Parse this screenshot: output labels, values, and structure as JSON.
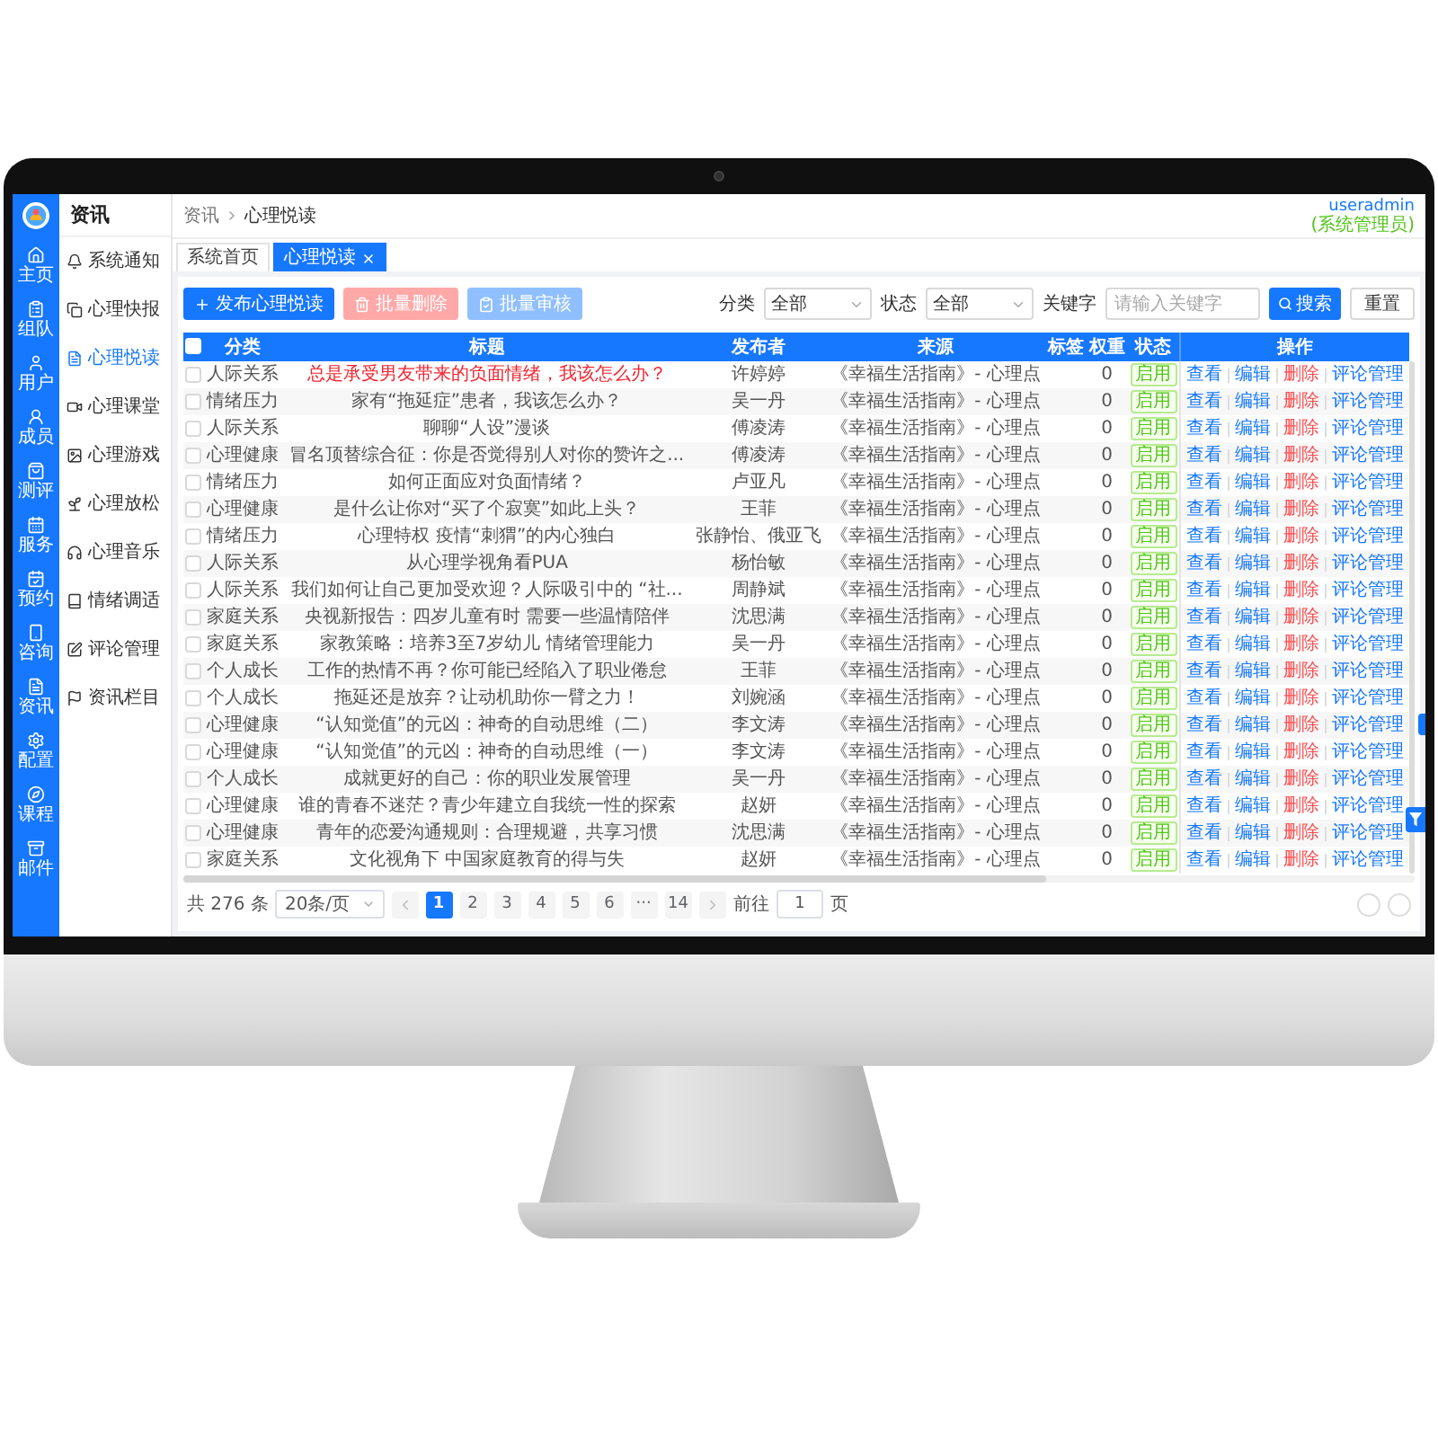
{
  "nav_sidebar": {
    "items": [
      "主页",
      "组队",
      "用户",
      "成员",
      "测评",
      "服务",
      "预约",
      "咨询",
      "资讯",
      "配置",
      "课程",
      "邮件"
    ]
  },
  "sub_sidebar": {
    "title": "资讯",
    "items": [
      {
        "label": "系统通知",
        "selected": false
      },
      {
        "label": "心理快报",
        "selected": false
      },
      {
        "label": "心理悦读",
        "selected": true
      },
      {
        "label": "心理课堂",
        "selected": false
      },
      {
        "label": "心理游戏",
        "selected": false
      },
      {
        "label": "心理放松",
        "selected": false
      },
      {
        "label": "心理音乐",
        "selected": false
      },
      {
        "label": "情绪调适",
        "selected": false
      },
      {
        "label": "评论管理",
        "selected": false
      },
      {
        "label": "资讯栏目",
        "selected": false
      }
    ]
  },
  "breadcrumb": [
    "资讯",
    "心理悦读"
  ],
  "user": {
    "name": "useradmin",
    "role": "(系统管理员)"
  },
  "tabs": [
    {
      "label": "系统首页",
      "selected": false,
      "closable": false
    },
    {
      "label": "心理悦读",
      "selected": true,
      "closable": true
    }
  ],
  "toolbar": {
    "buttons": [
      {
        "kind": "add",
        "label": "发布心理悦读",
        "disabled": false
      },
      {
        "kind": "delete",
        "label": "批量删除",
        "disabled": true
      },
      {
        "kind": "review",
        "label": "批量审核",
        "disabled": true
      }
    ],
    "filters": [
      {
        "kind": "select",
        "label": "分类",
        "value": "全部"
      },
      {
        "kind": "select",
        "label": "状态",
        "value": "全部"
      },
      {
        "kind": "input",
        "label": "关键字",
        "placeholder": "请输入关键字"
      }
    ],
    "search_button": "搜索",
    "reset_button": "重置"
  },
  "table": {
    "select_all_checked": false,
    "columns": [
      "分类",
      "标题",
      "发布者",
      "来源",
      "标签",
      "权重",
      "状态",
      "操作"
    ],
    "rows": [
      {
        "checked": false,
        "category": "人际关系",
        "title": "总是承受男友带来的负面情绪，我该怎么办？",
        "highlighted": true,
        "author": "许婷婷",
        "source": "《幸福生活指南》- 心理点",
        "weight": "0",
        "status": "启用",
        "actions": [
          {
            "label": "查看",
            "kind": "link"
          },
          {
            "label": "编辑",
            "kind": "link"
          },
          {
            "label": "删除",
            "kind": "danger"
          },
          {
            "label": "评论管理",
            "kind": "link"
          }
        ]
      },
      {
        "checked": false,
        "category": "情绪压力",
        "title": "家有“拖延症”患者，我该怎么办？",
        "highlighted": false,
        "author": "吴一丹",
        "source": "《幸福生活指南》- 心理点",
        "weight": "0",
        "status": "启用",
        "actions": [
          {
            "label": "查看",
            "kind": "link"
          },
          {
            "label": "编辑",
            "kind": "link"
          },
          {
            "label": "删除",
            "kind": "danger"
          },
          {
            "label": "评论管理",
            "kind": "link"
          }
        ]
      },
      {
        "checked": false,
        "category": "人际关系",
        "title": "聊聊“人设”漫谈",
        "highlighted": false,
        "author": "傅凌涛",
        "source": "《幸福生活指南》- 心理点",
        "weight": "0",
        "status": "启用",
        "actions": [
          {
            "label": "查看",
            "kind": "link"
          },
          {
            "label": "编辑",
            "kind": "link"
          },
          {
            "label": "删除",
            "kind": "danger"
          },
          {
            "label": "评论管理",
            "kind": "link"
          }
        ]
      },
      {
        "checked": false,
        "category": "心理健康",
        "title": "冒名顶替综合征：你是否觉得别人对你的赞许之...",
        "highlighted": false,
        "author": "傅凌涛",
        "source": "《幸福生活指南》- 心理点",
        "weight": "0",
        "status": "启用",
        "actions": [
          {
            "label": "查看",
            "kind": "link"
          },
          {
            "label": "编辑",
            "kind": "link"
          },
          {
            "label": "删除",
            "kind": "danger"
          },
          {
            "label": "评论管理",
            "kind": "link"
          }
        ]
      },
      {
        "checked": false,
        "category": "情绪压力",
        "title": "如何正面应对负面情绪？",
        "highlighted": false,
        "author": "卢亚凡",
        "source": "《幸福生活指南》- 心理点",
        "weight": "0",
        "status": "启用",
        "actions": [
          {
            "label": "查看",
            "kind": "link"
          },
          {
            "label": "编辑",
            "kind": "link"
          },
          {
            "label": "删除",
            "kind": "danger"
          },
          {
            "label": "评论管理",
            "kind": "link"
          }
        ]
      },
      {
        "checked": false,
        "category": "心理健康",
        "title": "是什么让你对“买了个寂寞”如此上头？",
        "highlighted": false,
        "author": "王菲",
        "source": "《幸福生活指南》- 心理点",
        "weight": "0",
        "status": "启用",
        "actions": [
          {
            "label": "查看",
            "kind": "link"
          },
          {
            "label": "编辑",
            "kind": "link"
          },
          {
            "label": "删除",
            "kind": "danger"
          },
          {
            "label": "评论管理",
            "kind": "link"
          }
        ]
      },
      {
        "checked": false,
        "category": "情绪压力",
        "title": "心理特权 疫情“刺猬”的内心独白",
        "highlighted": false,
        "author": "张静怡、俄亚飞",
        "source": "《幸福生活指南》- 心理点",
        "weight": "0",
        "status": "启用",
        "actions": [
          {
            "label": "查看",
            "kind": "link"
          },
          {
            "label": "编辑",
            "kind": "link"
          },
          {
            "label": "删除",
            "kind": "danger"
          },
          {
            "label": "评论管理",
            "kind": "link"
          }
        ]
      },
      {
        "checked": false,
        "category": "人际关系",
        "title": "从心理学视角看PUA",
        "highlighted": false,
        "author": "杨怡敏",
        "source": "《幸福生活指南》- 心理点",
        "weight": "0",
        "status": "启用",
        "actions": [
          {
            "label": "查看",
            "kind": "link"
          },
          {
            "label": "编辑",
            "kind": "link"
          },
          {
            "label": "删除",
            "kind": "danger"
          },
          {
            "label": "评论管理",
            "kind": "link"
          }
        ]
      },
      {
        "checked": false,
        "category": "人际关系",
        "title": "我们如何让自己更加受欢迎？人际吸引中的 “社...",
        "highlighted": false,
        "author": "周静斌",
        "source": "《幸福生活指南》- 心理点",
        "weight": "0",
        "status": "启用",
        "actions": [
          {
            "label": "查看",
            "kind": "link"
          },
          {
            "label": "编辑",
            "kind": "link"
          },
          {
            "label": "删除",
            "kind": "danger"
          },
          {
            "label": "评论管理",
            "kind": "link"
          }
        ]
      },
      {
        "checked": false,
        "category": "家庭关系",
        "title": "央视新报告：四岁儿童有时 需要一些温情陪伴",
        "highlighted": false,
        "author": "沈思满",
        "source": "《幸福生活指南》- 心理点",
        "weight": "0",
        "status": "启用",
        "actions": [
          {
            "label": "查看",
            "kind": "link"
          },
          {
            "label": "编辑",
            "kind": "link"
          },
          {
            "label": "删除",
            "kind": "danger"
          },
          {
            "label": "评论管理",
            "kind": "link"
          }
        ]
      },
      {
        "checked": false,
        "category": "家庭关系",
        "title": "家教策略：培养3至7岁幼儿 情绪管理能力",
        "highlighted": false,
        "author": "吴一丹",
        "source": "《幸福生活指南》- 心理点",
        "weight": "0",
        "status": "启用",
        "actions": [
          {
            "label": "查看",
            "kind": "link"
          },
          {
            "label": "编辑",
            "kind": "link"
          },
          {
            "label": "删除",
            "kind": "danger"
          },
          {
            "label": "评论管理",
            "kind": "link"
          }
        ]
      },
      {
        "checked": false,
        "category": "个人成长",
        "title": "工作的热情不再？你可能已经陷入了职业倦怠",
        "highlighted": false,
        "author": "王菲",
        "source": "《幸福生活指南》- 心理点",
        "weight": "0",
        "status": "启用",
        "actions": [
          {
            "label": "查看",
            "kind": "link"
          },
          {
            "label": "编辑",
            "kind": "link"
          },
          {
            "label": "删除",
            "kind": "danger"
          },
          {
            "label": "评论管理",
            "kind": "link"
          }
        ]
      },
      {
        "checked": false,
        "category": "个人成长",
        "title": "拖延还是放弃？让动机助你一臂之力！",
        "highlighted": false,
        "author": "刘婉涵",
        "source": "《幸福生活指南》- 心理点",
        "weight": "0",
        "status": "启用",
        "actions": [
          {
            "label": "查看",
            "kind": "link"
          },
          {
            "label": "编辑",
            "kind": "link"
          },
          {
            "label": "删除",
            "kind": "danger"
          },
          {
            "label": "评论管理",
            "kind": "link"
          }
        ]
      },
      {
        "checked": false,
        "category": "心理健康",
        "title": "“认知觉值”的元凶：神奇的自动思维（二）",
        "highlighted": false,
        "author": "李文涛",
        "source": "《幸福生活指南》- 心理点",
        "weight": "0",
        "status": "启用",
        "actions": [
          {
            "label": "查看",
            "kind": "link"
          },
          {
            "label": "编辑",
            "kind": "link"
          },
          {
            "label": "删除",
            "kind": "danger"
          },
          {
            "label": "评论管理",
            "kind": "link"
          }
        ]
      },
      {
        "checked": false,
        "category": "心理健康",
        "title": "“认知觉值”的元凶：神奇的自动思维（一）",
        "highlighted": false,
        "author": "李文涛",
        "source": "《幸福生活指南》- 心理点",
        "weight": "0",
        "status": "启用",
        "actions": [
          {
            "label": "查看",
            "kind": "link"
          },
          {
            "label": "编辑",
            "kind": "link"
          },
          {
            "label": "删除",
            "kind": "danger"
          },
          {
            "label": "评论管理",
            "kind": "link"
          }
        ]
      },
      {
        "checked": false,
        "category": "个人成长",
        "title": "成就更好的自己：你的职业发展管理",
        "highlighted": false,
        "author": "吴一丹",
        "source": "《幸福生活指南》- 心理点",
        "weight": "0",
        "status": "启用",
        "actions": [
          {
            "label": "查看",
            "kind": "link"
          },
          {
            "label": "编辑",
            "kind": "link"
          },
          {
            "label": "删除",
            "kind": "danger"
          },
          {
            "label": "评论管理",
            "kind": "link"
          }
        ]
      },
      {
        "checked": false,
        "category": "心理健康",
        "title": "谁的青春不迷茫？青少年建立自我统一性的探索",
        "highlighted": false,
        "author": "赵妍",
        "source": "《幸福生活指南》- 心理点",
        "weight": "0",
        "status": "启用",
        "actions": [
          {
            "label": "查看",
            "kind": "link"
          },
          {
            "label": "编辑",
            "kind": "link"
          },
          {
            "label": "删除",
            "kind": "danger"
          },
          {
            "label": "评论管理",
            "kind": "link"
          }
        ]
      },
      {
        "checked": false,
        "category": "心理健康",
        "title": "青年的恋爱沟通规则：合理规避，共享习惯",
        "highlighted": false,
        "author": "沈思满",
        "source": "《幸福生活指南》- 心理点",
        "weight": "0",
        "status": "启用",
        "actions": [
          {
            "label": "查看",
            "kind": "link"
          },
          {
            "label": "编辑",
            "kind": "link"
          },
          {
            "label": "删除",
            "kind": "danger"
          },
          {
            "label": "评论管理",
            "kind": "link"
          }
        ]
      },
      {
        "checked": false,
        "category": "家庭关系",
        "title": "文化视角下 中国家庭教育的得与失",
        "highlighted": false,
        "author": "赵妍",
        "source": "《幸福生活指南》- 心理点",
        "weight": "0",
        "status": "启用",
        "actions": [
          {
            "label": "查看",
            "kind": "link"
          },
          {
            "label": "编辑",
            "kind": "link"
          },
          {
            "label": "删除",
            "kind": "danger"
          },
          {
            "label": "评论管理",
            "kind": "link"
          }
        ]
      }
    ]
  },
  "pagination": {
    "total": "共 276 条",
    "page_size": "20条/页",
    "pages": [
      {
        "label": "1",
        "selected": true
      },
      {
        "label": "2",
        "selected": false
      },
      {
        "label": "3",
        "selected": false
      },
      {
        "label": "4",
        "selected": false
      },
      {
        "label": "5",
        "selected": false
      },
      {
        "label": "6",
        "selected": false
      },
      {
        "label": "···",
        "selected": false
      },
      {
        "label": "14",
        "selected": false
      }
    ],
    "goto_label": "前往",
    "goto_value": "1",
    "goto_suffix": "页"
  }
}
